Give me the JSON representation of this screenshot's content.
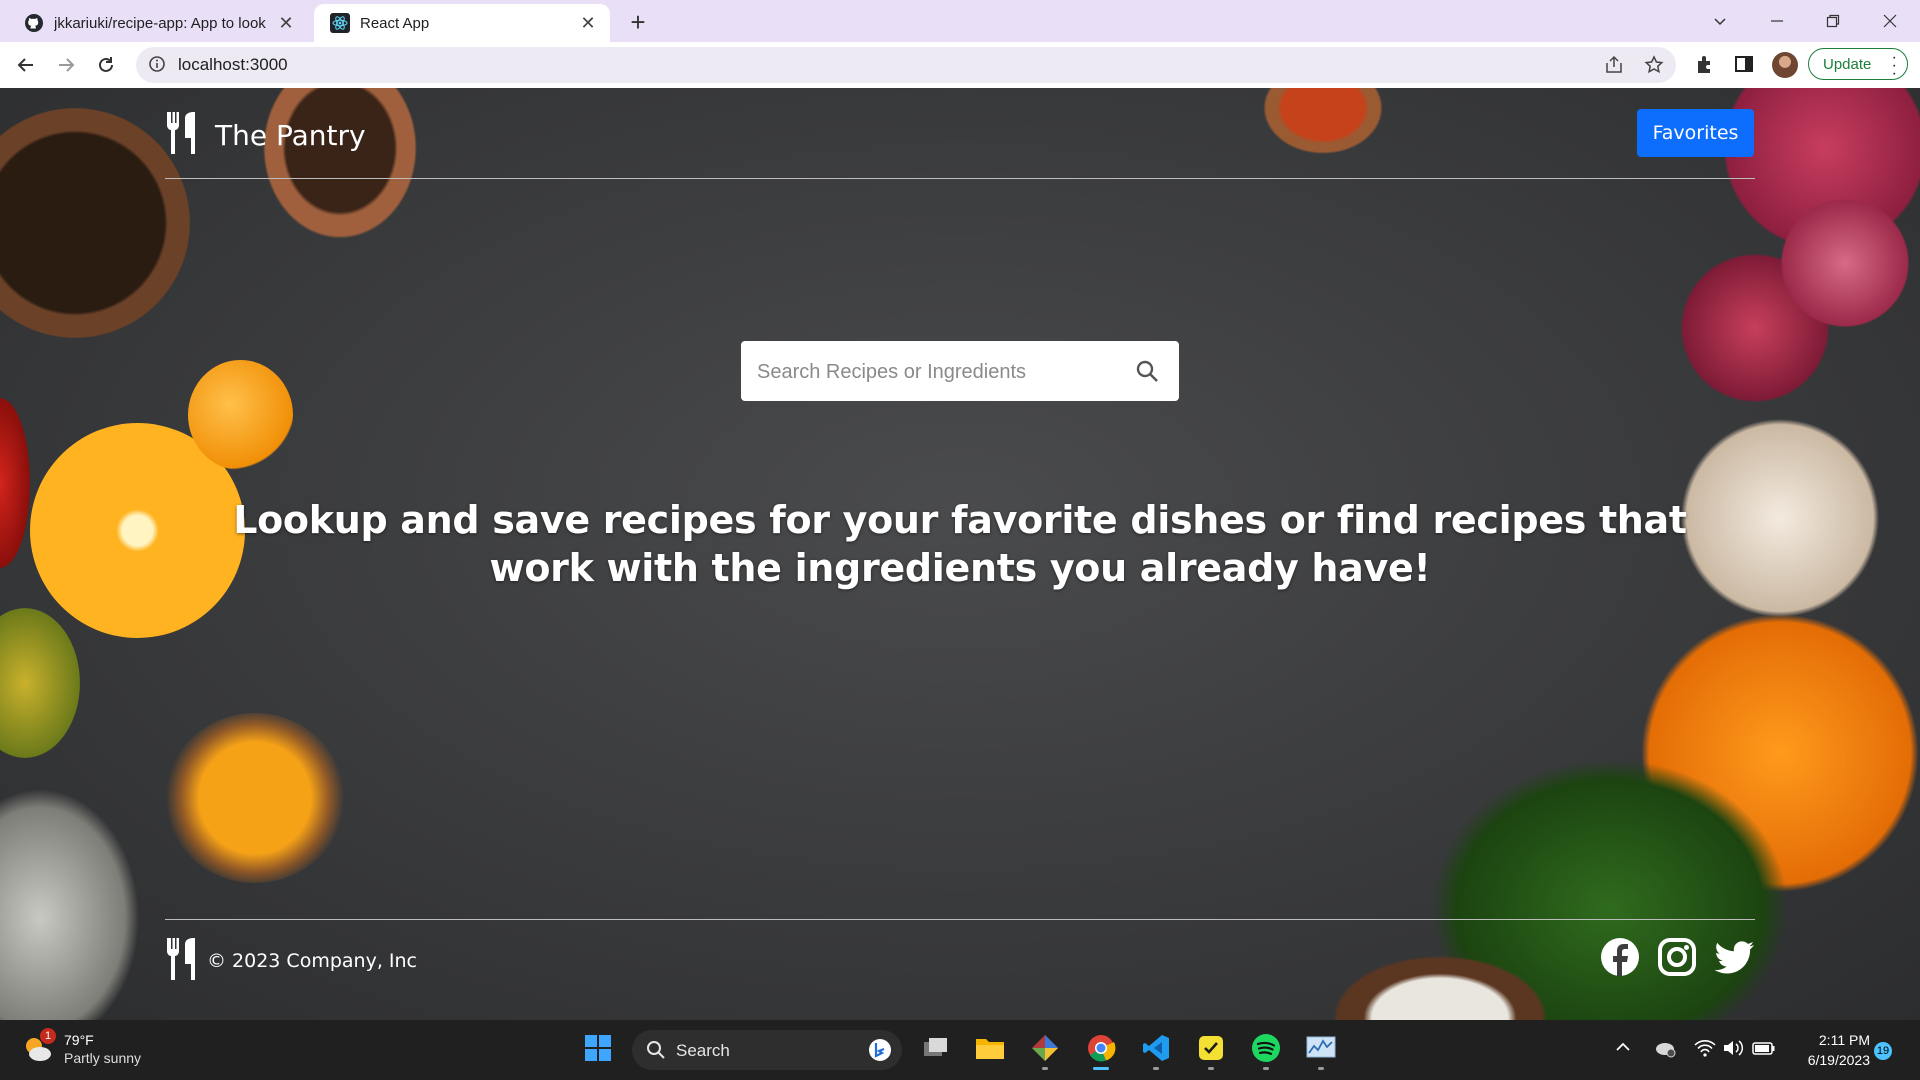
{
  "browser": {
    "tabs": [
      {
        "title": "jkkariuki/recipe-app: App to look",
        "favicon": "github-icon",
        "active": false
      },
      {
        "title": "React App",
        "favicon": "react-icon",
        "active": true
      }
    ],
    "address": "localhost:3000",
    "update_label": "Update",
    "colors": {
      "tabstrip": "#e9dff7",
      "omnibox": "#eeeaf4",
      "update": "#1b7e3c"
    }
  },
  "page": {
    "brand": "The Pantry",
    "brand_icon": "utensils-icon",
    "favorites_label": "Favorites",
    "search_placeholder": "Search Recipes or Ingredients",
    "search_value": "",
    "tagline": "Lookup and save recipes for your favorite dishes or find recipes that work with the ingredients you already have!",
    "footer_copy": "© 2023 Company, Inc",
    "social": [
      "facebook-icon",
      "instagram-icon",
      "twitter-icon"
    ],
    "colors": {
      "primary": "#0d6efd",
      "text": "#ffffff"
    }
  },
  "taskbar": {
    "weather_temp": "79°F",
    "weather_cond": "Partly sunny",
    "weather_badge": "1",
    "search_label": "Search",
    "time": "2:11 PM",
    "date": "6/19/2023",
    "notifications": "19"
  }
}
